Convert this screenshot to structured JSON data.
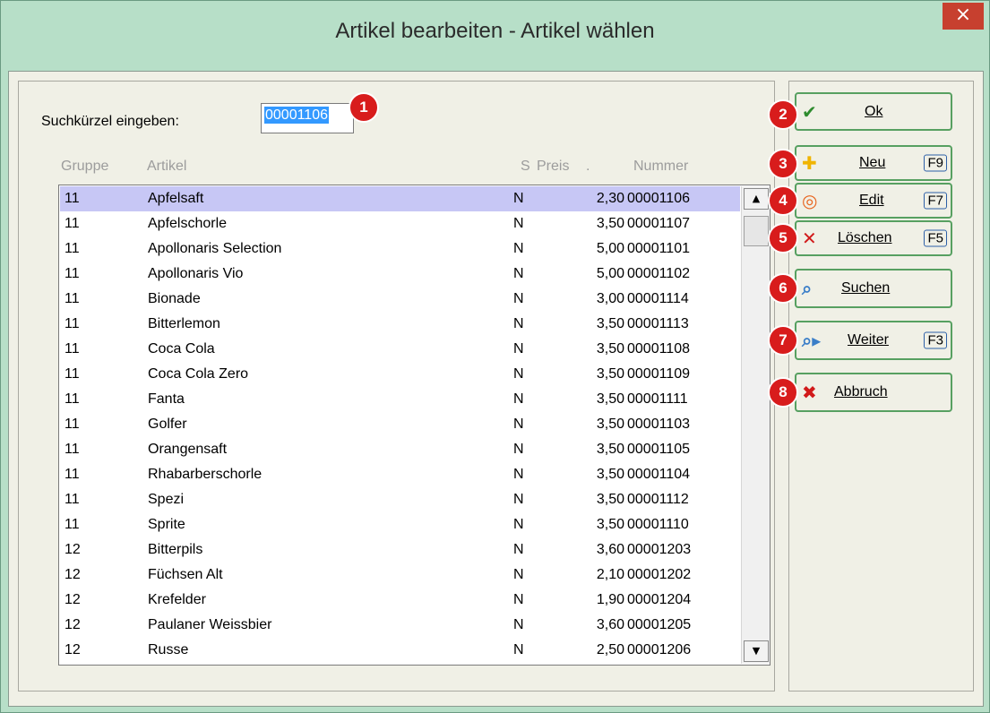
{
  "window": {
    "title": "Artikel bearbeiten - Artikel wählen",
    "close_icon": "×"
  },
  "search": {
    "label": "Suchkürzel eingeben:",
    "value": "00001106"
  },
  "columns": {
    "gruppe": "Gruppe",
    "artikel": "Artikel",
    "s": "S",
    "preis": "Preis",
    "dot": ".",
    "nummer": "Nummer"
  },
  "rows": [
    {
      "g": "11",
      "a": "Apfelsaft",
      "s": "N",
      "p": "2,30",
      "n": "00001106"
    },
    {
      "g": "11",
      "a": "Apfelschorle",
      "s": "N",
      "p": "3,50",
      "n": "00001107"
    },
    {
      "g": "11",
      "a": "Apollonaris Selection",
      "s": "N",
      "p": "5,00",
      "n": "00001101"
    },
    {
      "g": "11",
      "a": "Apollonaris Vio",
      "s": "N",
      "p": "5,00",
      "n": "00001102"
    },
    {
      "g": "11",
      "a": "Bionade",
      "s": "N",
      "p": "3,00",
      "n": "00001114"
    },
    {
      "g": "11",
      "a": "Bitterlemon",
      "s": "N",
      "p": "3,50",
      "n": "00001113"
    },
    {
      "g": "11",
      "a": "Coca Cola",
      "s": "N",
      "p": "3,50",
      "n": "00001108"
    },
    {
      "g": "11",
      "a": "Coca Cola Zero",
      "s": "N",
      "p": "3,50",
      "n": "00001109"
    },
    {
      "g": "11",
      "a": "Fanta",
      "s": "N",
      "p": "3,50",
      "n": "00001111"
    },
    {
      "g": "11",
      "a": "Golfer",
      "s": "N",
      "p": "3,50",
      "n": "00001103"
    },
    {
      "g": "11",
      "a": "Orangensaft",
      "s": "N",
      "p": "3,50",
      "n": "00001105"
    },
    {
      "g": "11",
      "a": "Rhabarberschorle",
      "s": "N",
      "p": "3,50",
      "n": "00001104"
    },
    {
      "g": "11",
      "a": "Spezi",
      "s": "N",
      "p": "3,50",
      "n": "00001112"
    },
    {
      "g": "11",
      "a": "Sprite",
      "s": "N",
      "p": "3,50",
      "n": "00001110"
    },
    {
      "g": "12",
      "a": "Bitterpils",
      "s": "N",
      "p": "3,60",
      "n": "00001203"
    },
    {
      "g": "12",
      "a": "Füchsen Alt",
      "s": "N",
      "p": "2,10",
      "n": "00001202"
    },
    {
      "g": "12",
      "a": "Krefelder",
      "s": "N",
      "p": "1,90",
      "n": "00001204"
    },
    {
      "g": "12",
      "a": "Paulaner Weissbier",
      "s": "N",
      "p": "3,60",
      "n": "00001205"
    },
    {
      "g": "12",
      "a": "Russe",
      "s": "N",
      "p": "2,50",
      "n": "00001206"
    }
  ],
  "selected_row": "Apfelsaft",
  "buttons": {
    "ok": {
      "label": "Ok",
      "icon": "checkmark-icon"
    },
    "neu": {
      "label": "Neu",
      "key": "F9",
      "icon": "plus-icon"
    },
    "edit": {
      "label": "Edit",
      "key": "F7",
      "icon": "ring-icon"
    },
    "loeschen": {
      "label": "Löschen",
      "key": "F5",
      "icon": "x-icon"
    },
    "suchen": {
      "label": "Suchen",
      "icon": "magnifier-icon"
    },
    "weiter": {
      "label": "Weiter",
      "key": "F3",
      "icon": "magnifier-next-icon"
    },
    "abbruch": {
      "label": "Abbruch",
      "icon": "cancel-icon"
    }
  },
  "badges": [
    "1",
    "2",
    "3",
    "4",
    "5",
    "6",
    "7",
    "8"
  ],
  "colors": {
    "titlebar": "#b7dfc8",
    "selection": "#c7c7f5",
    "badge": "#d81c1c",
    "button_border": "#57a061"
  }
}
